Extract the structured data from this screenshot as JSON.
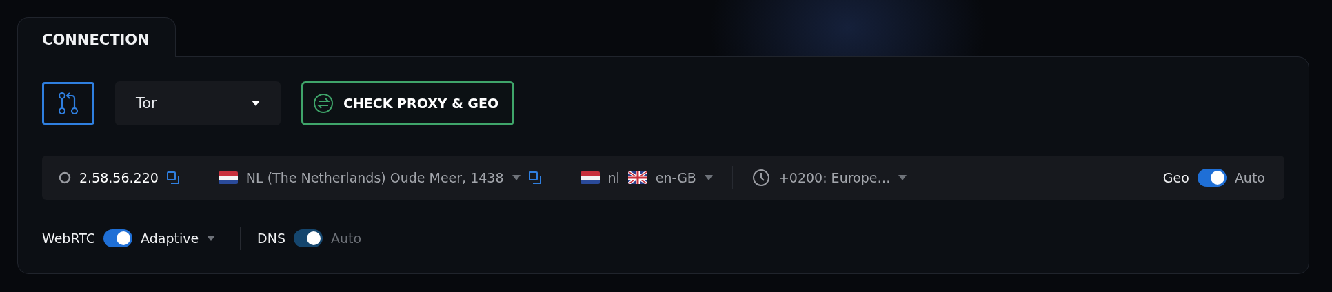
{
  "tab": {
    "label": "CONNECTION",
    "selected": true
  },
  "connection_type": {
    "value": "Tor"
  },
  "check_button": {
    "label": "CHECK PROXY & GEO"
  },
  "info_bar": {
    "ip": "2.58.56.220",
    "location": {
      "kind": "netherlands",
      "text": "NL (The Netherlands) Oude Meer, 1438"
    },
    "language": [
      {
        "kind": "netherlands",
        "text": "nl"
      },
      {
        "kind": "britain",
        "text": "en-GB"
      }
    ],
    "timezone": "+0200: Europe…",
    "geo": {
      "label": "Geo",
      "on": true,
      "mode": "Auto"
    }
  },
  "webrtc": {
    "label": "WebRTC",
    "on": true,
    "disabled": false,
    "mode": "Adaptive"
  },
  "dns": {
    "label": "DNS",
    "on": true,
    "disabled": true,
    "mode": "Auto"
  }
}
